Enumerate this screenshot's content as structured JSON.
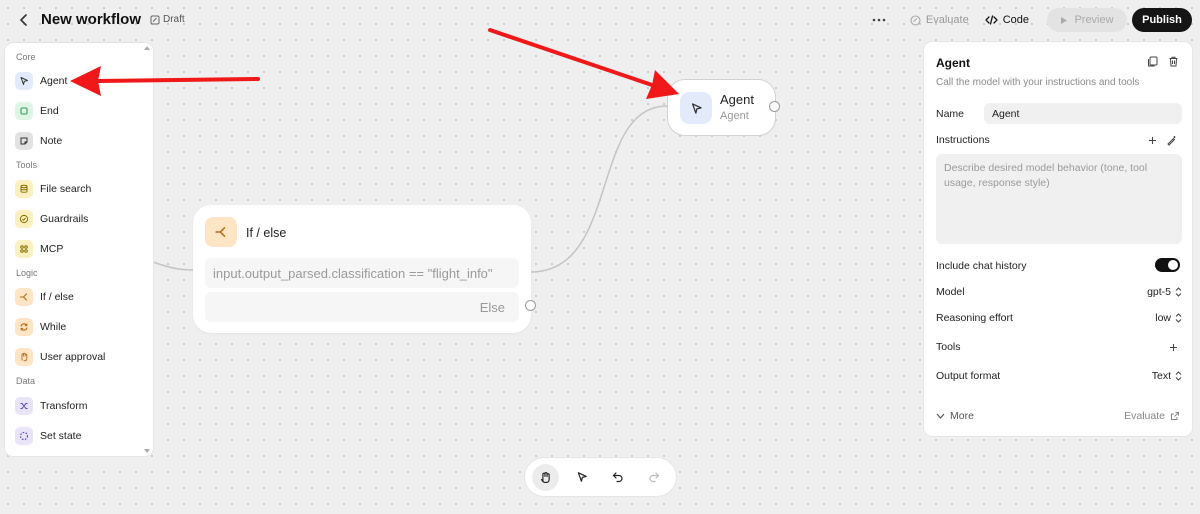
{
  "header": {
    "title": "New workflow",
    "draft_label": "Draft",
    "evaluate_label": "Evaluate",
    "code_label": "Code",
    "preview_label": "Preview",
    "publish_label": "Publish"
  },
  "sidebar": {
    "sections": [
      {
        "label": "Core",
        "items": [
          {
            "label": "Agent",
            "icon": "cursor-icon"
          },
          {
            "label": "End",
            "icon": "stop-icon"
          },
          {
            "label": "Note",
            "icon": "note-icon"
          }
        ]
      },
      {
        "label": "Tools",
        "items": [
          {
            "label": "File search",
            "icon": "database-icon"
          },
          {
            "label": "Guardrails",
            "icon": "shield-check-icon"
          },
          {
            "label": "MCP",
            "icon": "mcp-icon"
          }
        ]
      },
      {
        "label": "Logic",
        "items": [
          {
            "label": "If / else",
            "icon": "branch-icon"
          },
          {
            "label": "While",
            "icon": "loop-icon"
          },
          {
            "label": "User approval",
            "icon": "hand-icon"
          }
        ]
      },
      {
        "label": "Data",
        "items": [
          {
            "label": "Transform",
            "icon": "shuffle-icon"
          },
          {
            "label": "Set state",
            "icon": "dashed-circle-icon"
          }
        ]
      }
    ]
  },
  "canvas": {
    "ifelse_node": {
      "title": "If / else",
      "condition": "input.output_parsed.classification == \"flight_info\"",
      "else_label": "Else"
    },
    "agent_node": {
      "title": "Agent",
      "subtitle": "Agent"
    }
  },
  "panel": {
    "title": "Agent",
    "description": "Call the model with your instructions and tools",
    "name_label": "Name",
    "name_value": "Agent",
    "instructions_label": "Instructions",
    "instructions_placeholder": "Describe desired model behavior (tone, tool usage, response style)",
    "chat_history_label": "Include chat history",
    "chat_history_on": true,
    "model_label": "Model",
    "model_value": "gpt-5",
    "reasoning_label": "Reasoning effort",
    "reasoning_value": "low",
    "tools_label": "Tools",
    "output_format_label": "Output format",
    "output_format_value": "Text",
    "more_label": "More",
    "evaluate_label": "Evaluate"
  },
  "colors": {
    "annotation_arrow": "#f01818",
    "publish_bg": "#151515",
    "agent_icon_bg": "#e3ebfb",
    "ifelse_icon_bg": "#fde5c6"
  }
}
